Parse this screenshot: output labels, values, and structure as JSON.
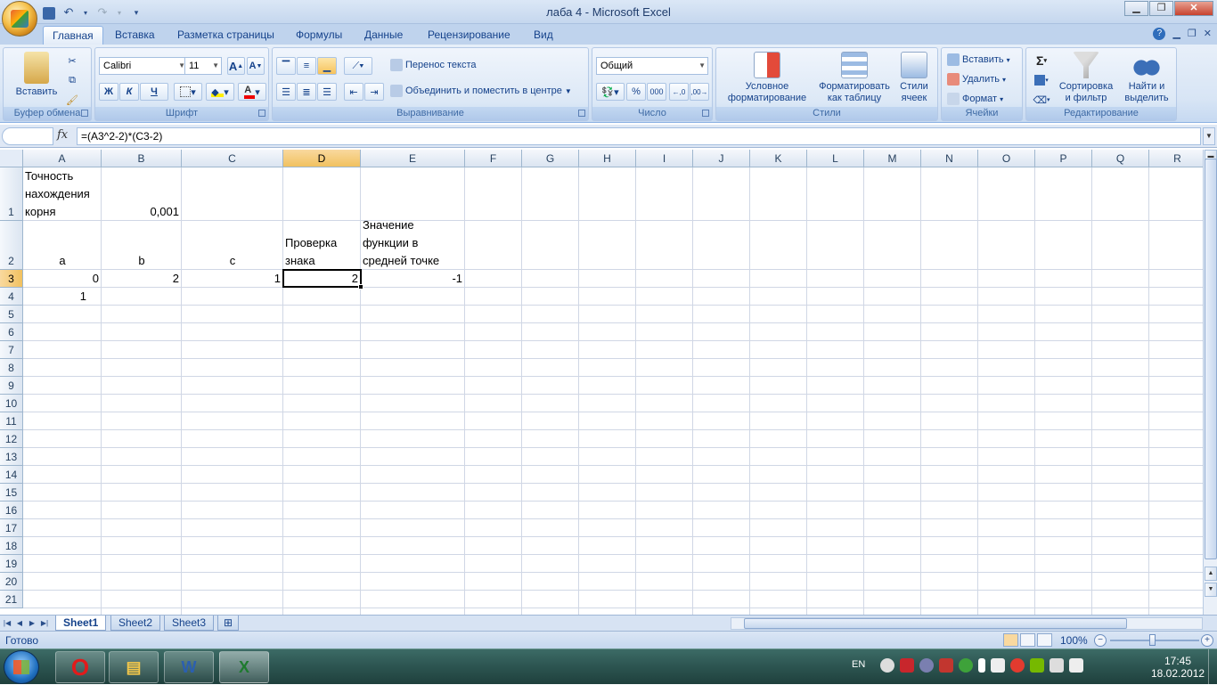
{
  "window": {
    "title": "лаба 4 - Microsoft Excel"
  },
  "ribbon_tabs": [
    "Главная",
    "Вставка",
    "Разметка страницы",
    "Формулы",
    "Данные",
    "Рецензирование",
    "Вид"
  ],
  "groups": {
    "clipboard": {
      "label": "Буфер обмена",
      "paste": "Вставить"
    },
    "font": {
      "label": "Шрифт",
      "font_name": "Calibri",
      "font_size": "11",
      "bold": "Ж",
      "italic": "К",
      "underline": "Ч"
    },
    "alignment": {
      "label": "Выравнивание",
      "wrap_text": "Перенос текста",
      "merge_center": "Объединить и поместить в центре"
    },
    "number": {
      "label": "Число",
      "format": "Общий",
      "percent": "%",
      "thousands": "000"
    },
    "styles": {
      "label": "Стили",
      "conditional_line1": "Условное",
      "conditional_line2": "форматирование",
      "format_table_line1": "Форматировать",
      "format_table_line2": "как таблицу",
      "cell_styles_line1": "Стили",
      "cell_styles_line2": "ячеек"
    },
    "cells": {
      "label": "Ячейки",
      "insert": "Вставить",
      "delete": "Удалить",
      "format": "Формат"
    },
    "editing": {
      "label": "Редактирование",
      "sum": "Σ",
      "sort_line1": "Сортировка",
      "sort_line2": "и фильтр",
      "find_line1": "Найти и",
      "find_line2": "выделить"
    }
  },
  "formula_bar": {
    "fx": "fx",
    "formula": "=(A3^2-2)*(C3-2)"
  },
  "columns": [
    "A",
    "B",
    "C",
    "D",
    "E",
    "F",
    "G",
    "H",
    "I",
    "J",
    "K",
    "L",
    "M",
    "N",
    "O",
    "P",
    "Q",
    "R"
  ],
  "rows": [
    "1",
    "2",
    "3",
    "4",
    "5",
    "6",
    "7",
    "8",
    "9",
    "10",
    "11",
    "12",
    "13",
    "14",
    "15",
    "16",
    "17",
    "18",
    "19",
    "20",
    "21"
  ],
  "cells": {
    "A1_line1": "Точность",
    "A1_line2": "нахождения",
    "A1_line3": "корня",
    "B1": "0,001",
    "A2": "a",
    "B2": "b",
    "C2": "c",
    "D2_line1": "Проверка",
    "D2_line2": "знака",
    "E2_line1": "Значение",
    "E2_line2": "функции в",
    "E2_line3": "средней точке",
    "A3": "0",
    "B3": "2",
    "C3": "1",
    "D3": "2",
    "E3": "-1",
    "A4": "1"
  },
  "sheets": [
    "Sheet1",
    "Sheet2",
    "Sheet3"
  ],
  "active_sheet": "Sheet1",
  "status": {
    "ready": "Готово",
    "zoom": "100%"
  },
  "taskbar": {
    "lang": "EN",
    "time": "17:45",
    "date": "18.02.2012"
  },
  "colors": {
    "accent": "#15428b",
    "selected_header": "#f9d99f",
    "ribbon_bg": "#dbe7f6",
    "taskbar": "#2c5450"
  }
}
